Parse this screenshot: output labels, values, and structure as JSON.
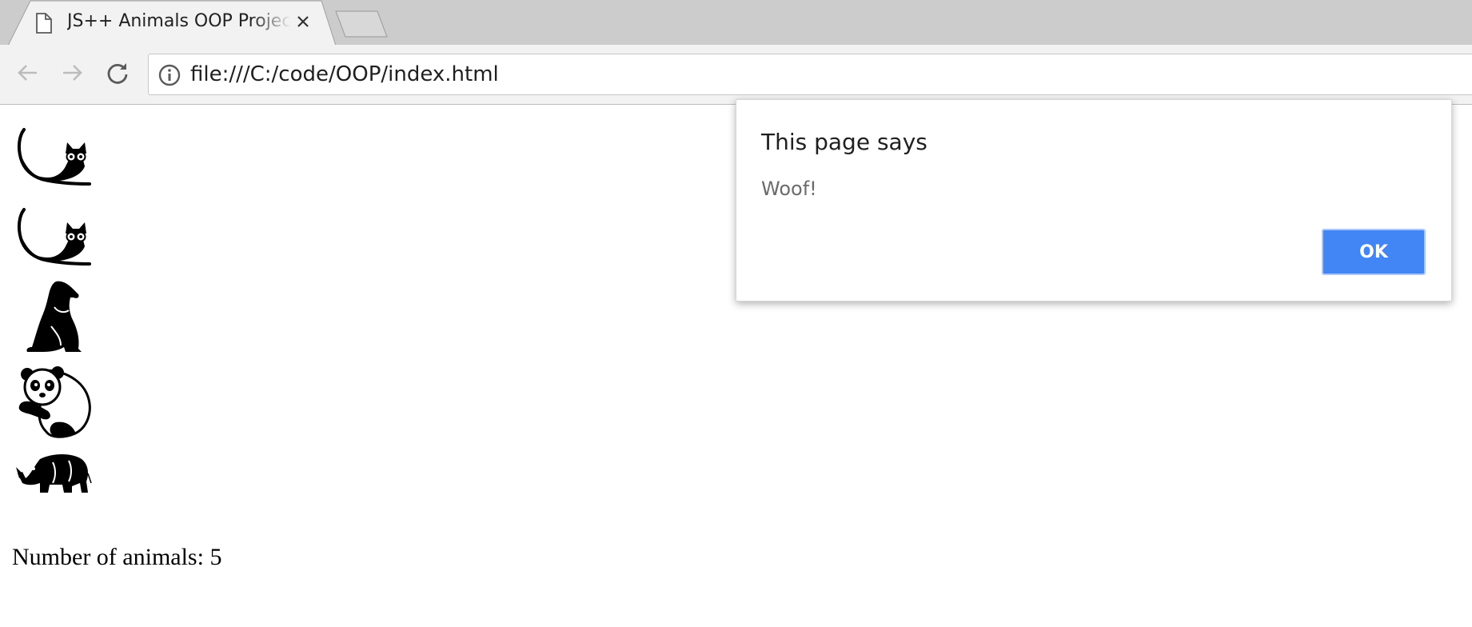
{
  "browser": {
    "tab_title": "JS++ Animals OOP Project",
    "url": "file:///C:/code/OOP/index.html"
  },
  "page": {
    "animals": [
      {
        "kind": "cat",
        "icon": "cat-icon"
      },
      {
        "kind": "cat",
        "icon": "cat-icon"
      },
      {
        "kind": "dog",
        "icon": "dog-icon"
      },
      {
        "kind": "panda",
        "icon": "panda-icon"
      },
      {
        "kind": "rhino",
        "icon": "rhino-icon"
      }
    ],
    "count_text": "Number of animals: 5"
  },
  "dialog": {
    "title": "This page says",
    "message": "Woof!",
    "ok_label": "OK"
  },
  "colors": {
    "tabstrip": "#cccccc",
    "toolbar": "#f2f2f2",
    "ok_button": "#4285f4"
  }
}
